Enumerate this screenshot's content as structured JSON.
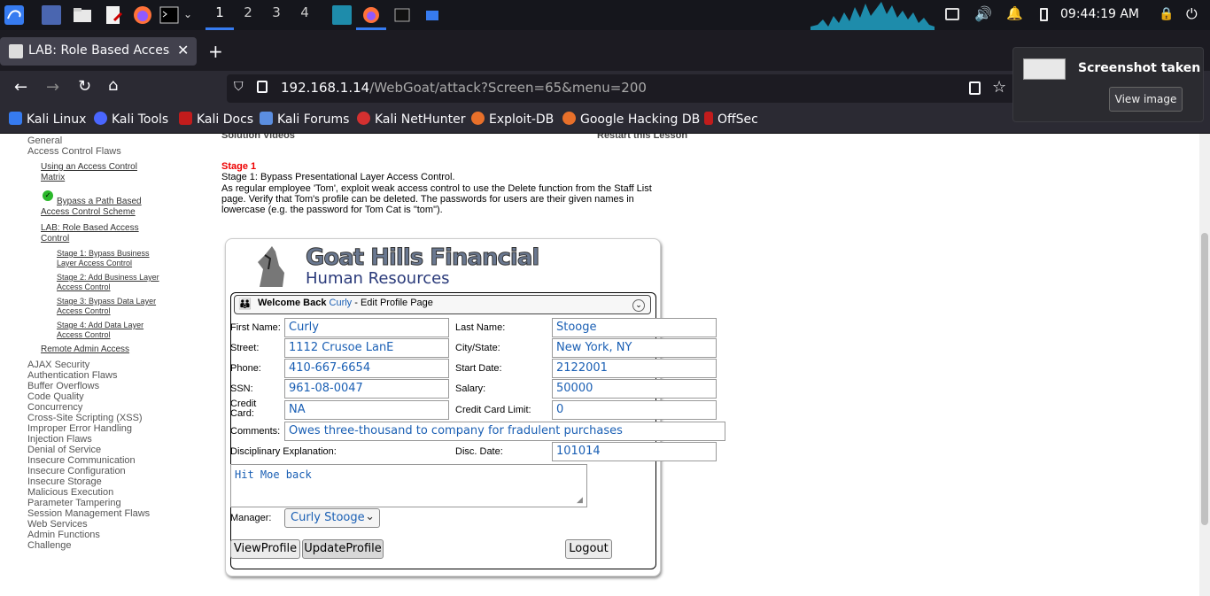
{
  "taskbar": {
    "workspaces": [
      "1",
      "2",
      "3",
      "4"
    ],
    "clock": "09:44:19 AM"
  },
  "browser": {
    "tab_title": "LAB: Role Based Access C",
    "url_host": "192.168.1.14",
    "url_path": "/WebGoat/attack?Screen=65&menu=200",
    "bookmarks": [
      "Kali Linux",
      "Kali Tools",
      "Kali Docs",
      "Kali Forums",
      "Kali NetHunter",
      "Exploit-DB",
      "Google Hacking DB",
      "OffSec"
    ]
  },
  "notification": {
    "title": "Screenshot taken",
    "button": "View image"
  },
  "sidebar": {
    "general": "General",
    "acf": "Access Control Flaws",
    "acf_items": [
      "Using an Access Control Matrix",
      "Bypass a Path Based Access Control Scheme",
      "LAB: Role Based Access Control"
    ],
    "stages": [
      "Stage 1: Bypass Business Layer Access Control",
      "Stage 2: Add Business Layer Access Control",
      "Stage 3: Bypass Data Layer Access Control",
      "Stage 4: Add Data Layer Access Control"
    ],
    "remote_admin": "Remote Admin Access",
    "categories": [
      "AJAX Security",
      "Authentication Flaws",
      "Buffer Overflows",
      "Code Quality",
      "Concurrency",
      "Cross-Site Scripting (XSS)",
      "Improper Error Handling",
      "Injection Flaws",
      "Denial of Service",
      "Insecure Communication",
      "Insecure Configuration",
      "Insecure Storage",
      "Malicious Execution",
      "Parameter Tampering",
      "Session Management Flaws",
      "Web Services",
      "Admin Functions",
      "Challenge"
    ]
  },
  "lesson": {
    "solution_videos": "Solution Videos",
    "restart": "Restart this Lesson",
    "stage_title": "Stage 1",
    "stage_sub": "Stage 1: Bypass Presentational Layer Access Control.",
    "desc1": "As regular employee 'Tom', exploit weak access control to use the Delete function from the Staff List",
    "desc2": "page. Verify that Tom's profile can be deleted. The passwords for users are their given names in",
    "desc3": "lowercase (e.g. the password for Tom Cat is \"tom\")."
  },
  "app": {
    "logo_line1": "Goat Hills Financial",
    "logo_line2": "Human Resources",
    "welcome": "Welcome Back",
    "user": "Curly",
    "page": " - Edit Profile Page",
    "labels": {
      "first_name": "First Name:",
      "last_name": "Last Name:",
      "street": "Street:",
      "city_state": "City/State:",
      "phone": "Phone:",
      "start_date": "Start Date:",
      "ssn": "SSN:",
      "salary": "Salary:",
      "credit_card_1": "Credit",
      "credit_card_2": "Card:",
      "cc_limit": "Credit Card Limit:",
      "comments": "Comments:",
      "disciplinary": "Disciplinary Explanation:",
      "disc_date": "Disc. Date:",
      "manager": "Manager:"
    },
    "values": {
      "first_name": "Curly",
      "last_name": "Stooge",
      "street": "1112 Crusoe LanE",
      "city_state": "New York, NY",
      "phone": "410-667-6654",
      "start_date": "2122001",
      "ssn": "961-08-0047",
      "salary": "50000",
      "credit_card": "NA",
      "cc_limit": "0",
      "comments": "Owes three-thousand to company for fradulent purchases",
      "disc_date": "101014",
      "disciplinary": "Hit Moe back",
      "manager": "Curly Stooge"
    },
    "buttons": {
      "view": "ViewProfile",
      "update": "UpdateProfile",
      "logout": "Logout"
    }
  }
}
